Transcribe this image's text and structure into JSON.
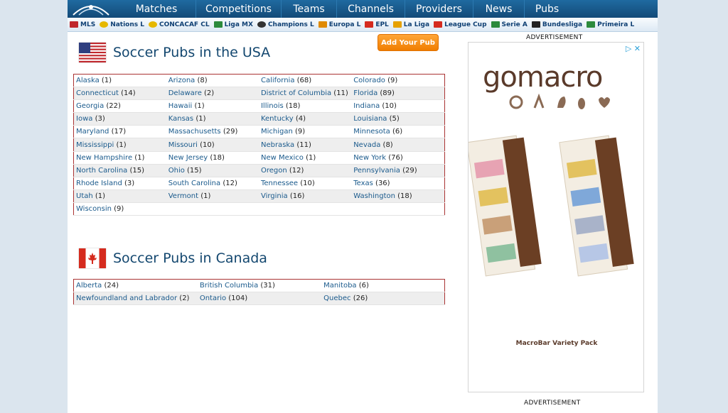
{
  "nav": {
    "items": [
      "Matches",
      "Competitions",
      "Teams",
      "Channels",
      "Providers",
      "News",
      "Pubs"
    ]
  },
  "leagues": [
    {
      "label": "MLS",
      "icon": "us-flag-icon"
    },
    {
      "label": "Nations L",
      "icon": "nations-league-icon"
    },
    {
      "label": "CONCACAF CL",
      "icon": "concacaf-icon"
    },
    {
      "label": "Liga MX",
      "icon": "mexico-flag-icon"
    },
    {
      "label": "Champions L",
      "icon": "football-icon"
    },
    {
      "label": "Europa L",
      "icon": "europa-trophy-icon"
    },
    {
      "label": "EPL",
      "icon": "england-flag-icon"
    },
    {
      "label": "La Liga",
      "icon": "spain-flag-icon"
    },
    {
      "label": "League Cup",
      "icon": "england-flag-icon"
    },
    {
      "label": "Serie A",
      "icon": "italy-flag-icon"
    },
    {
      "label": "Bundesliga",
      "icon": "germany-flag-icon"
    },
    {
      "label": "Primeira L",
      "icon": "portugal-flag-icon"
    }
  ],
  "add_pub": "Add Your Pub",
  "usa": {
    "title": "Soccer Pubs in the USA",
    "rows": [
      [
        [
          "Alaska",
          "(1)"
        ],
        [
          "Arizona",
          "(8)"
        ],
        [
          "California",
          "(68)"
        ],
        [
          "Colorado",
          "(9)"
        ]
      ],
      [
        [
          "Connecticut",
          "(14)"
        ],
        [
          "Delaware",
          "(2)"
        ],
        [
          "District of Columbia",
          "(11)"
        ],
        [
          "Florida",
          "(89)"
        ]
      ],
      [
        [
          "Georgia",
          "(22)"
        ],
        [
          "Hawaii",
          "(1)"
        ],
        [
          "Illinois",
          "(18)"
        ],
        [
          "Indiana",
          "(10)"
        ]
      ],
      [
        [
          "Iowa",
          "(3)"
        ],
        [
          "Kansas",
          "(1)"
        ],
        [
          "Kentucky",
          "(4)"
        ],
        [
          "Louisiana",
          "(5)"
        ]
      ],
      [
        [
          "Maryland",
          "(17)"
        ],
        [
          "Massachusetts",
          "(29)"
        ],
        [
          "Michigan",
          "(9)"
        ],
        [
          "Minnesota",
          "(6)"
        ]
      ],
      [
        [
          "Mississippi",
          "(1)"
        ],
        [
          "Missouri",
          "(10)"
        ],
        [
          "Nebraska",
          "(11)"
        ],
        [
          "Nevada",
          "(8)"
        ]
      ],
      [
        [
          "New Hampshire",
          "(1)"
        ],
        [
          "New Jersey",
          "(18)"
        ],
        [
          "New Mexico",
          "(1)"
        ],
        [
          "New York",
          "(76)"
        ]
      ],
      [
        [
          "North Carolina",
          "(15)"
        ],
        [
          "Ohio",
          "(15)"
        ],
        [
          "Oregon",
          "(12)"
        ],
        [
          "Pennsylvania",
          "(29)"
        ]
      ],
      [
        [
          "Rhode Island",
          "(3)"
        ],
        [
          "South Carolina",
          "(12)"
        ],
        [
          "Tennessee",
          "(10)"
        ],
        [
          "Texas",
          "(36)"
        ]
      ],
      [
        [
          "Utah",
          "(1)"
        ],
        [
          "Vermont",
          "(1)"
        ],
        [
          "Virginia",
          "(16)"
        ],
        [
          "Washington",
          "(18)"
        ]
      ],
      [
        [
          "Wisconsin",
          "(9)"
        ]
      ]
    ]
  },
  "canada": {
    "title": "Soccer Pubs in Canada",
    "rows": [
      [
        [
          "Alberta",
          "(24)"
        ],
        [
          "British Columbia",
          "(31)"
        ],
        [
          "Manitoba",
          "(6)"
        ]
      ],
      [
        [
          "Newfoundland and Labrador",
          "(2)"
        ],
        [
          "Ontario",
          "(104)"
        ],
        [
          "Quebec",
          "(26)"
        ]
      ]
    ]
  },
  "ad": {
    "label_top": "ADVERTISEMENT",
    "label_bottom": "ADVERTISEMENT",
    "brand": "gomacro",
    "caption": "MacroBar Variety Pack"
  },
  "colors": {
    "nav_bg": "#1a5e92",
    "link": "#1a5a8c",
    "table_border": "#aa3333",
    "button": "#f58a10"
  }
}
